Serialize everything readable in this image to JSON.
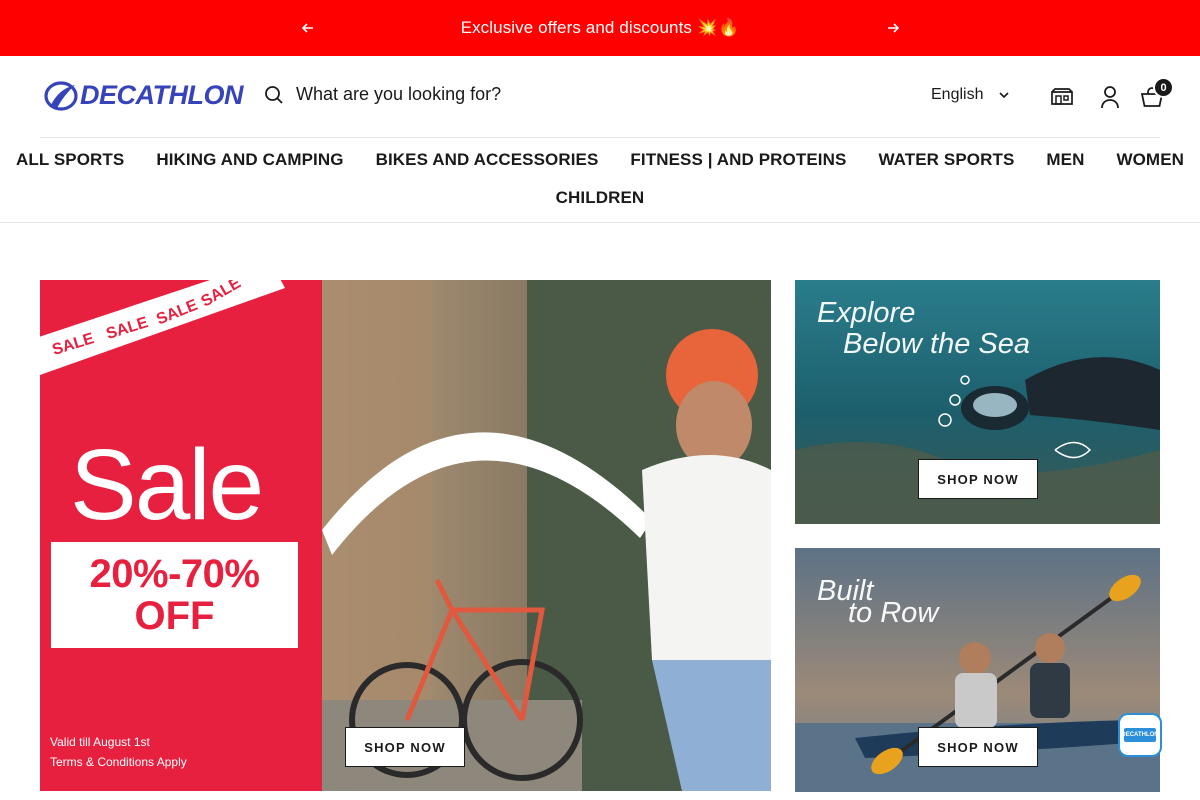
{
  "announcement": {
    "message": "Exclusive offers and discounts 💥🔥"
  },
  "header": {
    "logo_text": "DECATHLON",
    "search_placeholder": "What are you looking for?",
    "language": "English",
    "cart_count": "0"
  },
  "nav": {
    "row1": [
      "ALL SPORTS",
      "HIKING AND CAMPING",
      "BIKES AND ACCESSORIES",
      "FITNESS | AND PROTEINS",
      "WATER SPORTS",
      "MEN",
      "WOMEN"
    ],
    "row2": [
      "CHILDREN"
    ]
  },
  "hero": {
    "sale_word": "Sale",
    "discount_line1": "20%-70%",
    "discount_line2": "OFF",
    "validity": "Valid till August 1st",
    "terms": "Terms & Conditions Apply",
    "ribbon_word": "SALE",
    "button": "SHOP NOW"
  },
  "tiles": [
    {
      "title_line1": "Explore",
      "title_line2": "Below the Sea",
      "button": "SHOP NOW"
    },
    {
      "title_line1": "Built",
      "title_line2": "to Row",
      "button": "SHOP NOW"
    }
  ],
  "chat": {
    "label": "DECATHLON"
  },
  "colors": {
    "announcement_bg": "#ff0000",
    "brand_blue": "#3643ba",
    "sale_red": "#e8203f"
  }
}
